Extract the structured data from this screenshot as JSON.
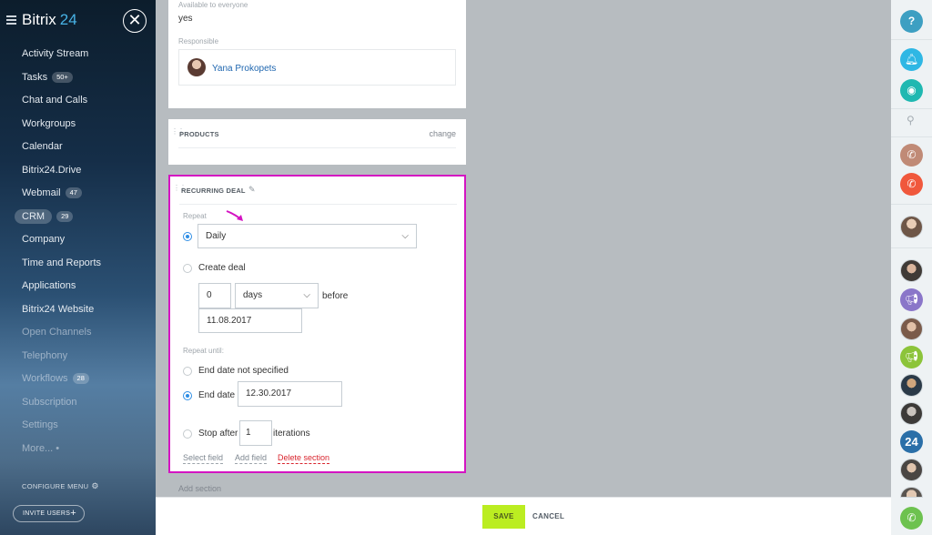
{
  "sidebar": {
    "logo": "Bitrix",
    "logo_num": "24",
    "items": [
      {
        "label": "Activity Stream"
      },
      {
        "label": "Tasks",
        "badge": "50+"
      },
      {
        "label": "Chat and Calls"
      },
      {
        "label": "Workgroups"
      },
      {
        "label": "Calendar"
      },
      {
        "label": "Bitrix24.Drive"
      },
      {
        "label": "Webmail",
        "badge": "47"
      },
      {
        "label": "CRM",
        "badge": "29"
      },
      {
        "label": "Company"
      },
      {
        "label": "Time and Reports"
      },
      {
        "label": "Applications"
      },
      {
        "label": "Bitrix24 Website"
      },
      {
        "label": "Open Channels"
      },
      {
        "label": "Telephony"
      },
      {
        "label": "Workflows",
        "badge": "28"
      },
      {
        "label": "Subscription"
      },
      {
        "label": "Settings"
      },
      {
        "label": "More...",
        "suffix": "•"
      }
    ],
    "configure_menu": "CONFIGURE MENU",
    "invite_users": "INVITE USERS"
  },
  "top_card": {
    "available_label": "Available to everyone",
    "available_value": "yes",
    "responsible_label": "Responsible",
    "responsible_name": "Yana Prokopets"
  },
  "products": {
    "title": "PRODUCTS",
    "change": "change"
  },
  "recurring": {
    "title": "RECURRING DEAL",
    "repeat_label": "Repeat",
    "repeat_value": "Daily",
    "create_deal": "Create deal",
    "days_count": "0",
    "days_unit": "days",
    "before": "before",
    "date": "11.08.2017",
    "repeat_until_label": "Repeat until:",
    "end_not_specified": "End date not specified",
    "end_date_label": "End date",
    "end_date_value": "12.30.2017",
    "stop_after": "Stop after",
    "iterations_value": "1",
    "iterations": "iterations",
    "select_field": "Select field",
    "add_field": "Add field",
    "delete_section": "Delete section"
  },
  "add_section": "Add section",
  "footer": {
    "save": "SAVE",
    "cancel": "CANCEL"
  },
  "rail": {
    "help": "?",
    "bitrix_num": "24"
  },
  "colors": {
    "highlight": "#d414c2",
    "save_button": "#bbed21",
    "radio_checked": "#2f8ee5",
    "delete_link": "#d9252e"
  }
}
